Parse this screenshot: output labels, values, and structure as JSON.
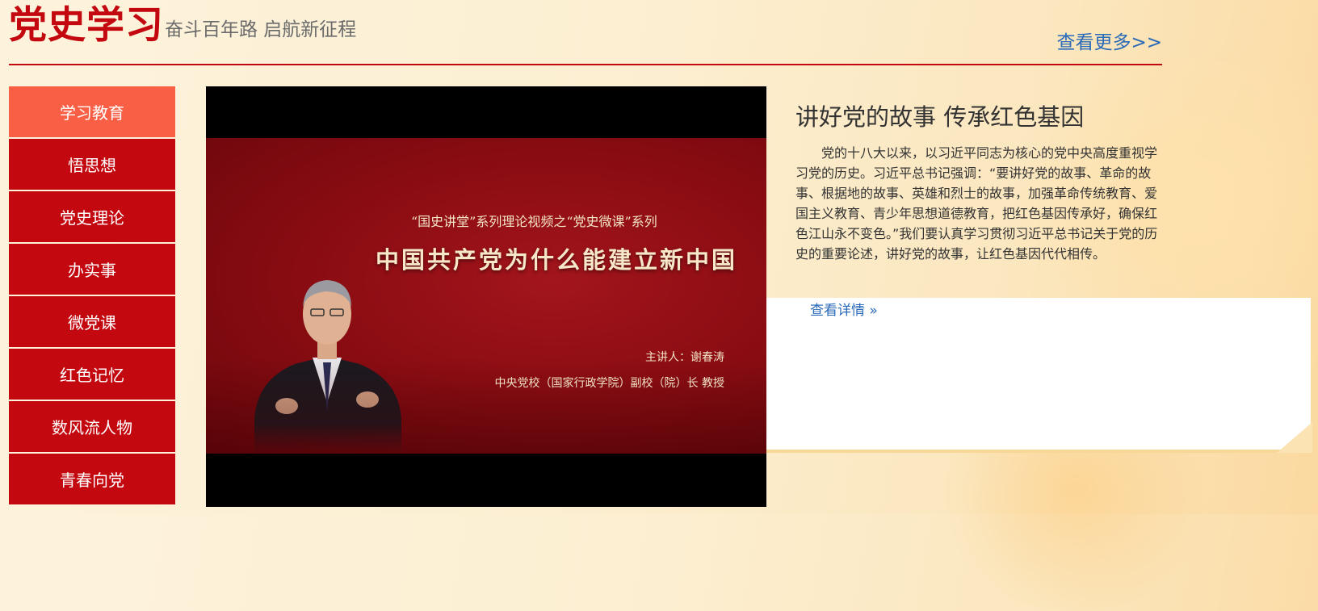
{
  "header": {
    "title": "党史学习",
    "subtitle": "奋斗百年路 启航新征程",
    "more_link": "查看更多>>"
  },
  "sidebar": {
    "items": [
      {
        "label": "学习教育",
        "active": true
      },
      {
        "label": "悟思想",
        "active": false
      },
      {
        "label": "党史理论",
        "active": false
      },
      {
        "label": "办实事",
        "active": false
      },
      {
        "label": "微党课",
        "active": false
      },
      {
        "label": "红色记忆",
        "active": false
      },
      {
        "label": "数风流人物",
        "active": false
      },
      {
        "label": "青春向党",
        "active": false
      }
    ]
  },
  "video": {
    "series_caption": "“国史讲堂”系列理论视频之“党史微课”系列",
    "headline": "中国共产党为什么能建立新中国",
    "lecturer": "主讲人：谢春涛",
    "affiliation": "中央党校（国家行政学院）副校（院）长 教授"
  },
  "article": {
    "title": "讲好党的故事 传承红色基因",
    "body": "党的十八大以来，以习近平同志为核心的党中央高度重视学习党的历史。习近平总书记强调：“要讲好党的故事、革命的故事、根据地的故事、英雄和烈士的故事，加强革命传统教育、爱国主义教育、青少年思想道德教育，把红色基因传承好，确保红色江山永不变色。”我们要认真学习贯彻习近平总书记关于党的历史的重要论述，讲好党的故事，让红色基因代代相传。",
    "detail_link": "查看详情 »"
  },
  "colors": {
    "brand_red": "#c3090f",
    "active_tab": "#f85f45",
    "link_blue": "#2a6ab8"
  }
}
